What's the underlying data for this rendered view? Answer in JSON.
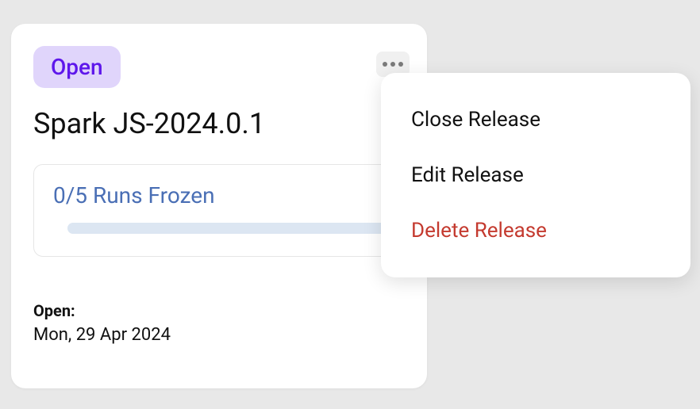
{
  "card": {
    "status": "Open",
    "title": "Spark JS-2024.0.1",
    "runs": {
      "text": "0/5 Runs Frozen",
      "frozen": 0,
      "total": 5
    },
    "openLabel": "Open:",
    "openDate": "Mon, 29 Apr 2024"
  },
  "menu": {
    "items": [
      {
        "label": "Close Release",
        "danger": false
      },
      {
        "label": "Edit Release",
        "danger": false
      },
      {
        "label": "Delete Release",
        "danger": true
      }
    ]
  }
}
